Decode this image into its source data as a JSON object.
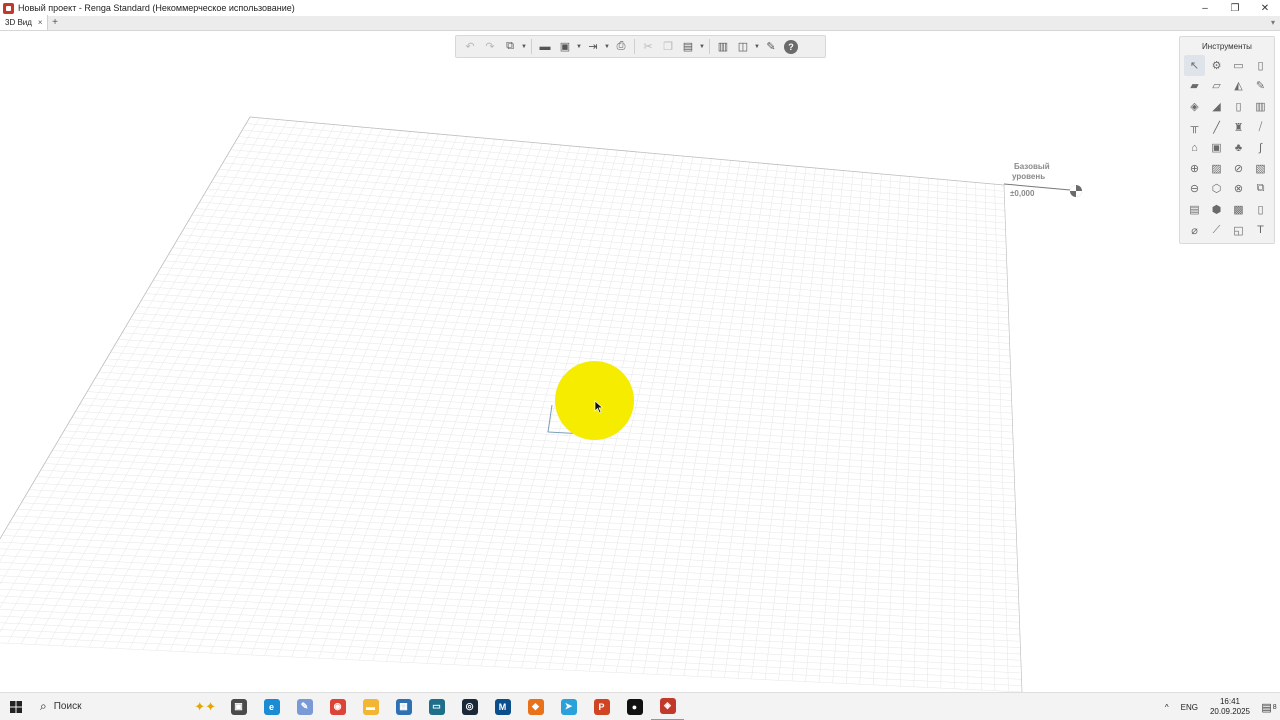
{
  "window": {
    "title": "Новый проект - Renga Standard (Некоммерческое использование)",
    "controls": {
      "minimize": "–",
      "restore": "❐",
      "close": "✕"
    }
  },
  "tabs": [
    {
      "label": "3D Вид",
      "close": "×"
    }
  ],
  "tab_add": "+",
  "tab_menu": "▾",
  "toolbar": {
    "buttons": [
      {
        "name": "undo-icon",
        "glyph": "↶"
      },
      {
        "name": "redo-icon",
        "glyph": "↷"
      },
      {
        "name": "copy-objects-icon",
        "glyph": "⧉"
      },
      {
        "name": "open-icon",
        "glyph": "▬"
      },
      {
        "name": "save-icon",
        "glyph": "▣"
      },
      {
        "name": "export-icon",
        "glyph": "⇥"
      },
      {
        "name": "print-icon",
        "glyph": "⎙"
      },
      {
        "name": "cut-icon",
        "glyph": "✂"
      },
      {
        "name": "copy-icon",
        "glyph": "❐"
      },
      {
        "name": "paste-icon",
        "glyph": "▤"
      },
      {
        "name": "properties-icon",
        "glyph": "▥"
      },
      {
        "name": "layers-icon",
        "glyph": "◫"
      },
      {
        "name": "settings-icon",
        "glyph": "✎"
      },
      {
        "name": "help-icon",
        "glyph": "?"
      }
    ]
  },
  "tools_panel": {
    "title": "Инструменты",
    "tools": [
      "select-icon",
      "reference-icon",
      "wall-icon",
      "column-icon",
      "beam-icon",
      "slab-icon",
      "roof-icon",
      "pen-icon",
      "floor-icon",
      "ramp-icon",
      "door-icon",
      "window-icon",
      "railing-icon",
      "line-icon",
      "equipment-icon",
      "rebar-icon",
      "pipe-icon",
      "room-icon",
      "plant-icon",
      "wire-icon",
      "duct-icon",
      "area-icon",
      "fitting-icon",
      "sheet-icon",
      "elevation-icon",
      "shape-icon",
      "valve-icon",
      "assembly-icon",
      "stair-icon",
      "hatch-icon",
      "image-icon",
      "opening-icon",
      "dimension-icon",
      "axis-icon",
      "block-icon",
      "text-icon"
    ],
    "text_tool_label": "T"
  },
  "level_marker": {
    "name_line1": "Базовый",
    "name_line2": "уровень",
    "elevation": "±0,000"
  },
  "taskbar": {
    "search_placeholder": "Поиск",
    "apps": [
      {
        "name": "task-view-icon",
        "color": "#4a4a4a",
        "glyph": "▣"
      },
      {
        "name": "edge-icon",
        "color": "#1b8bd3",
        "glyph": "e"
      },
      {
        "name": "paint-icon",
        "color": "#7a9ad6",
        "glyph": "✎"
      },
      {
        "name": "chrome-icon",
        "color": "#db4437",
        "glyph": "◉"
      },
      {
        "name": "file-explorer-icon",
        "color": "#f2b632",
        "glyph": "▬"
      },
      {
        "name": "calculator-icon",
        "color": "#2f6fb4",
        "glyph": "▦"
      },
      {
        "name": "terminal-icon",
        "color": "#1f6f8b",
        "glyph": "▭"
      },
      {
        "name": "steam-icon",
        "color": "#1b2838",
        "glyph": "◎"
      },
      {
        "name": "app-mf-icon",
        "color": "#0b4e8c",
        "glyph": "M"
      },
      {
        "name": "shield-app-icon",
        "color": "#e8711a",
        "glyph": "◆"
      },
      {
        "name": "telegram-icon",
        "color": "#2aa1da",
        "glyph": "➤"
      },
      {
        "name": "powerpoint-icon",
        "color": "#d04423",
        "glyph": "P"
      },
      {
        "name": "recorder-icon",
        "color": "#111111",
        "glyph": "●"
      },
      {
        "name": "renga-icon",
        "color": "#c0392b",
        "glyph": "◈"
      }
    ],
    "tray": {
      "chevron": "^",
      "language": "ENG",
      "time": "16:41",
      "date": "20.09.2025",
      "notification_badge": "8"
    }
  },
  "colors": {
    "highlight": "#f5ec00",
    "grid_line": "#e6e6e6",
    "grid_border": "#bdbdbd"
  }
}
